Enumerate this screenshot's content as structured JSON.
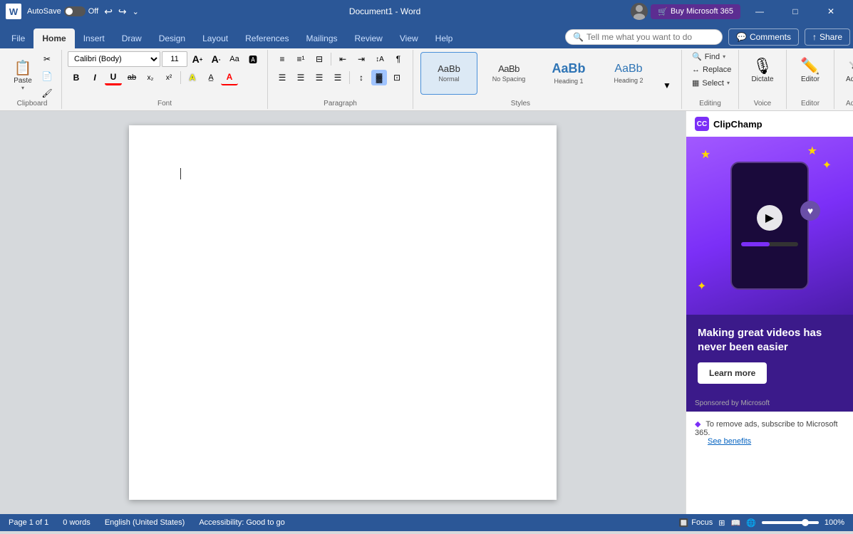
{
  "titleBar": {
    "appName": "W",
    "autosave": "AutoSave",
    "toggleState": "Off",
    "undoLabel": "↩",
    "redoLabel": "↪",
    "moreLabel": "⌄",
    "docTitle": "Document1 - Word",
    "buyBtn": "Buy Microsoft 365",
    "minimize": "—",
    "maximize": "□",
    "close": "✕"
  },
  "ribbonTabs": {
    "tabs": [
      "File",
      "Home",
      "Insert",
      "Draw",
      "Design",
      "Layout",
      "References",
      "Mailings",
      "Review",
      "View",
      "Help"
    ],
    "activeTab": "Home",
    "searchPlaceholder": "Tell me what you want to do",
    "commentsLabel": "Comments",
    "shareLabel": "Share"
  },
  "clipboard": {
    "label": "Clipboard",
    "paste": "Paste",
    "cut": "Cut",
    "copy": "Copy",
    "painter": "Format\nPainter"
  },
  "font": {
    "label": "Font",
    "fontName": "Calibri (Body)",
    "fontSize": "11",
    "growLabel": "A↑",
    "shrinkLabel": "A↓",
    "caseLabel": "Aa",
    "clearLabel": "A✕",
    "boldLabel": "B",
    "italicLabel": "I",
    "underlineLabel": "U",
    "strikeLabel": "ab",
    "subscriptLabel": "x₂",
    "superscriptLabel": "x²",
    "fontColorLabel": "A",
    "highlightLabel": "A",
    "textColorLabel": "A"
  },
  "paragraph": {
    "label": "Paragraph",
    "bulletList": "≡•",
    "numberedList": "≡1",
    "multilevel": "≡☰",
    "decreaseIndent": "⇤",
    "increaseIndent": "⇥",
    "sort": "↕A",
    "showHide": "¶",
    "alignLeft": "☰",
    "alignCenter": "☰",
    "alignRight": "☰",
    "justify": "☰",
    "lineSpacing": "↕",
    "shadingLabel": "Shading",
    "borders": "⊡"
  },
  "styles": {
    "label": "Styles",
    "items": [
      {
        "id": "normal",
        "label": "Normal",
        "active": true
      },
      {
        "id": "no-spacing",
        "label": "No Spacing",
        "active": false
      },
      {
        "id": "heading1",
        "label": "Heading 1",
        "active": false
      },
      {
        "id": "heading2",
        "label": "Heading 2",
        "active": false
      }
    ],
    "moreBtn": "▼"
  },
  "editing": {
    "label": "Editing",
    "find": "Find",
    "replace": "Replace",
    "select": "Select"
  },
  "voice": {
    "label": "Voice",
    "dictate": "Dictate",
    "editor": "Editor"
  },
  "addins": {
    "label": "Add-ins",
    "addins": "Add-ins"
  },
  "document": {
    "pageInfo": "Page 1 of 1",
    "words": "0 words",
    "language": "English (United States)",
    "accessibility": "Accessibility: Good to go"
  },
  "statusBar": {
    "focus": "Focus",
    "zoom": "100%"
  },
  "adPanel": {
    "appName": "ClipChamp",
    "tagline": "Making great videos has never been easier",
    "learnMore": "Learn more",
    "sponsored": "Sponsored by Microsoft",
    "footerText": "To remove ads, subscribe to Microsoft 365.",
    "seeBenefits": "See benefits"
  }
}
